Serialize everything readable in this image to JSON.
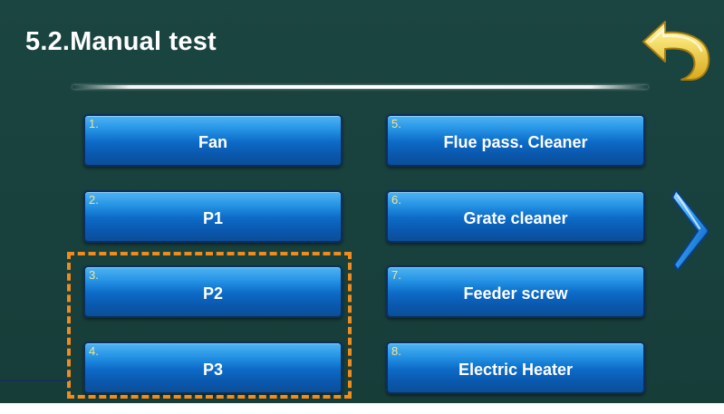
{
  "header": {
    "title": "5.2.Manual test"
  },
  "icons": {
    "back": "back-arrow-icon",
    "next": "chevron-right-icon"
  },
  "buttons": [
    {
      "number": "1.",
      "label": "Fan"
    },
    {
      "number": "2.",
      "label": "P1"
    },
    {
      "number": "3.",
      "label": "P2"
    },
    {
      "number": "4.",
      "label": "P3"
    },
    {
      "number": "5.",
      "label": "Flue pass. Cleaner"
    },
    {
      "number": "6.",
      "label": "Grate cleaner"
    },
    {
      "number": "7.",
      "label": "Feeder screw"
    },
    {
      "number": "8.",
      "label": "Electric Heater"
    }
  ],
  "colors": {
    "background": "#19423e",
    "button_top": "#4fb4f4",
    "button_bottom": "#0c4e98",
    "number_text": "#f6e58a",
    "highlight": "#f08c1e",
    "back_arrow": "#f2d64c",
    "next_chevron": "#1a84e0"
  }
}
